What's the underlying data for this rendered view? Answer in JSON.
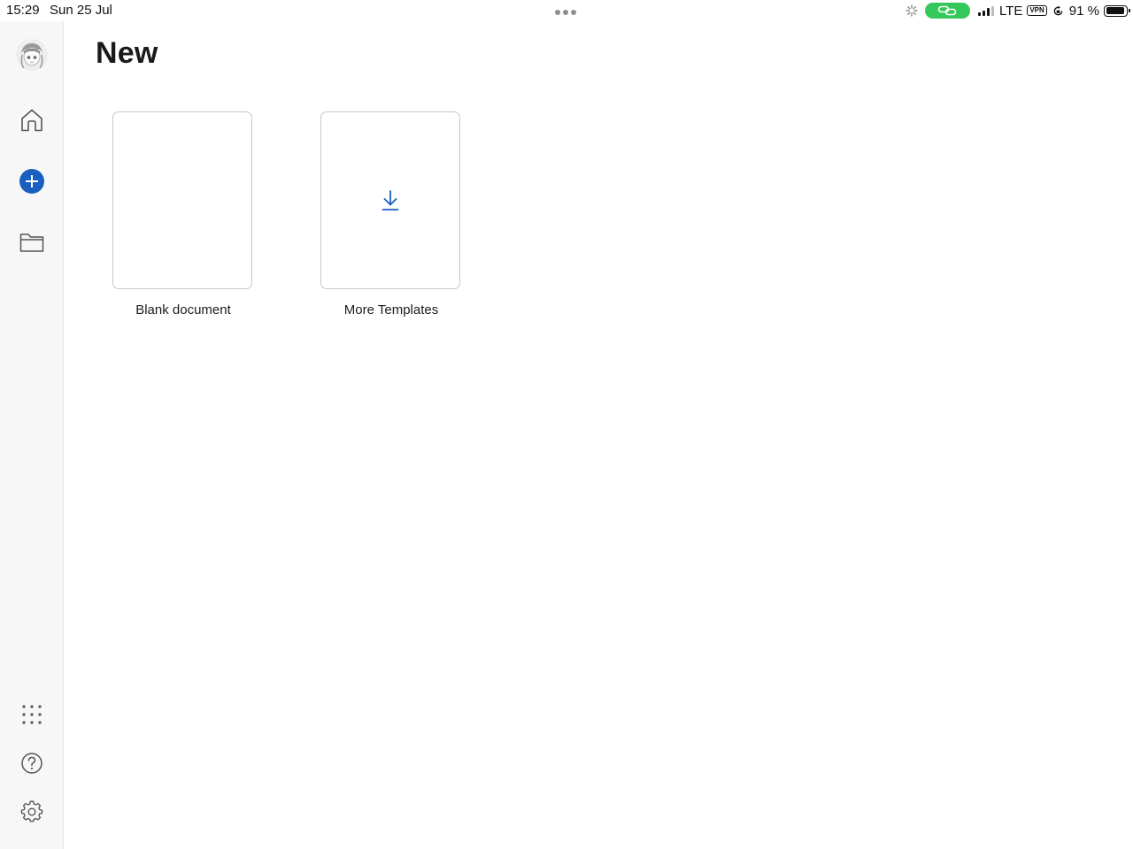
{
  "status_bar": {
    "time": "15:29",
    "date": "Sun 25 Jul",
    "network": "LTE",
    "vpn": "VPN",
    "battery": "91 %",
    "battery_level": 0.91
  },
  "sidebar": {
    "items": [
      {
        "icon": "avatar-icon"
      },
      {
        "icon": "home-icon"
      },
      {
        "icon": "plus-circle-icon",
        "active": true
      },
      {
        "icon": "folder-icon"
      },
      {
        "icon": "apps-grid-icon"
      },
      {
        "icon": "help-icon"
      },
      {
        "icon": "gear-icon"
      }
    ]
  },
  "main": {
    "title": "New",
    "tiles": [
      {
        "label": "Blank document",
        "icon": ""
      },
      {
        "label": "More Templates",
        "icon": "download-icon"
      }
    ]
  },
  "colors": {
    "accent": "#1a5fc0",
    "link_pill": "#34c759",
    "sidebar_bg": "#f7f7f7",
    "tile_border": "#c8c8c8"
  }
}
